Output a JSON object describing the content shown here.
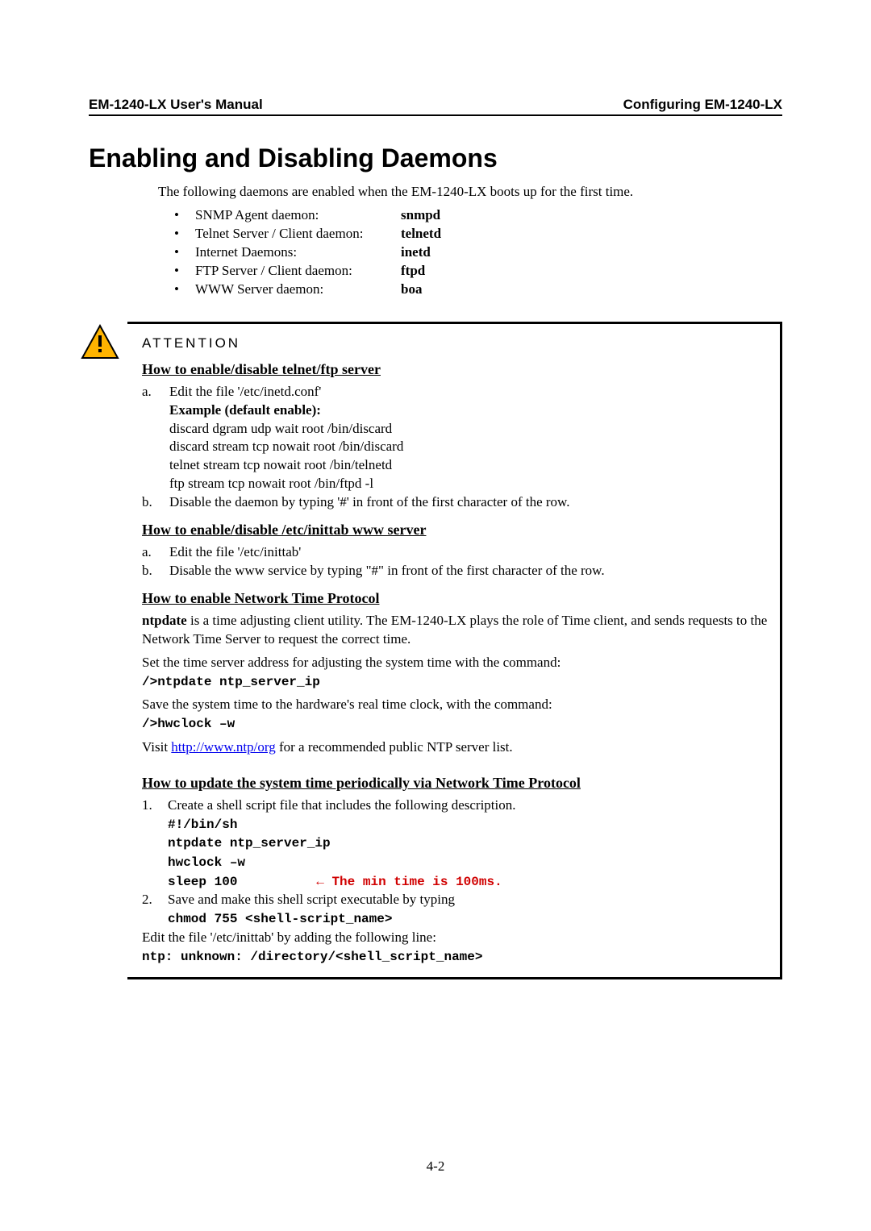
{
  "header": {
    "left": "EM-1240-LX User's Manual",
    "right": "Configuring EM-1240-LX"
  },
  "title": "Enabling and Disabling Daemons",
  "intro": "The following daemons are enabled when the EM-1240-LX boots up for the first time.",
  "daemons": [
    {
      "label": "SNMP Agent daemon:",
      "name": "snmpd"
    },
    {
      "label": "Telnet Server / Client daemon:",
      "name": "telnetd"
    },
    {
      "label": "Internet Daemons:",
      "name": "inetd"
    },
    {
      "label": "FTP Server / Client daemon:",
      "name": "ftpd"
    },
    {
      "label": "WWW Server daemon:",
      "name": "boa"
    }
  ],
  "attention": {
    "label": "ATTENTION",
    "s1": {
      "heading": "How to enable/disable telnet/ftp server",
      "a_lead": "Edit the file '/etc/inetd.conf'",
      "a_example_label": "Example (default enable):",
      "a_lines": [
        "discard dgram udp wait root /bin/discard",
        "discard stream tcp nowait root /bin/discard",
        "telnet stream tcp nowait root /bin/telnetd",
        "ftp stream tcp nowait root /bin/ftpd -l"
      ],
      "b": "Disable the daemon by typing '#' in front of the first character of the row."
    },
    "s2": {
      "heading": "How to enable/disable /etc/inittab www server",
      "a": "Edit the file '/etc/inittab'",
      "b": "Disable the www service by typing \"#\" in front of the first character of the row."
    },
    "s3": {
      "heading": "How to enable Network Time Protocol",
      "p1_bold": "ntpdate",
      "p1_rest": " is a time adjusting client utility. The EM-1240-LX plays the role of Time client, and sends requests to the Network Time Server to request the correct time.",
      "p2": "Set the time server address for adjusting the system time with the command:",
      "cmd1": "/>ntpdate ntp_server_ip",
      "p3": "Save the system time to the hardware's real time clock, with the command:",
      "cmd2": "/>hwclock –w",
      "p4_pre": "Visit ",
      "p4_link": "http://www.ntp/org",
      "p4_post": " for a recommended public NTP server list."
    },
    "s4": {
      "heading": "How to update the system time periodically via Network Time Protocol",
      "n1_lead": "Create a shell script file that includes the following description.",
      "script_lines": [
        "#!/bin/sh",
        "ntpdate ntp_server_ip",
        "hwclock –w"
      ],
      "sleep_line": "sleep 100",
      "sleep_note": "← The min time is 100ms.",
      "n2_lead": "Save and make this shell script executable by typing",
      "n2_cmd": "chmod 755 <shell-script_name>",
      "tail_text": "Edit the file '/etc/inittab' by adding the following line:",
      "tail_cmd": "ntp: unknown: /directory/<shell_script_name>"
    }
  },
  "page_number": "4-2"
}
